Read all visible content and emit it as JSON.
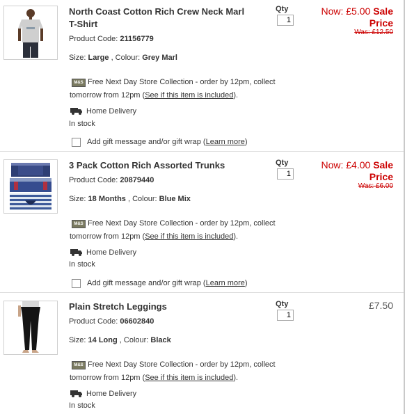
{
  "items": [
    {
      "title_line1": "North Coast Cotton Rich Crew Neck Marl",
      "title_line2": "T-Shirt",
      "product_code_label": "Product Code:",
      "product_code": "21156779",
      "size_label": "Size:",
      "size": "Large",
      "colour_label": ", Colour:",
      "colour": "Grey Marl",
      "qty_label": "Qty",
      "qty": "1",
      "price_now_prefix": "Now: £5.00",
      "price_now_sale": "Sale",
      "price_now_price": "Price",
      "price_was": "Was: £12.50",
      "store_line1": "Free Next Day Store Collection - order by 12pm, collect",
      "store_line2_pre": "tomorrow  from 12pm (",
      "store_link": "See if this item is included",
      "store_line2_post": ").",
      "home_delivery": "Home Delivery",
      "stock": "In stock",
      "gift_text": "Add gift message and/or gift wrap (",
      "gift_link": "Learn more",
      "gift_close": ")"
    },
    {
      "title_line1": "3 Pack Cotton Rich Assorted Trunks",
      "product_code_label": "Product Code:",
      "product_code": "20879440",
      "size_label": "Size:",
      "size": "18 Months",
      "colour_label": ", Colour:",
      "colour": "Blue Mix",
      "qty_label": "Qty",
      "qty": "1",
      "price_now_prefix": "Now: £4.00",
      "price_now_sale": "Sale",
      "price_now_price": "Price",
      "price_was": "Was: £6.00",
      "store_line1": "Free Next Day Store Collection - order by 12pm, collect",
      "store_line2_pre": "tomorrow  from 12pm (",
      "store_link": "See if this item is included",
      "store_line2_post": ").",
      "home_delivery": "Home Delivery",
      "stock": "In stock",
      "gift_text": "Add gift message and/or gift wrap (",
      "gift_link": "Learn more",
      "gift_close": ")"
    },
    {
      "title_line1": "Plain Stretch Leggings",
      "product_code_label": "Product Code:",
      "product_code": "06602840",
      "size_label": "Size:",
      "size": "14 Long",
      "colour_label": ", Colour:",
      "colour": "Black",
      "qty_label": "Qty",
      "qty": "1",
      "price": "£7.50",
      "store_line1": "Free Next Day Store Collection - order by 12pm, collect",
      "store_line2_pre": "tomorrow  from 12pm (",
      "store_link": "See if this item is included",
      "store_line2_post": ").",
      "home_delivery": "Home Delivery",
      "stock": "In stock"
    }
  ],
  "icons": {
    "store": "M&S",
    "delivery": "delivery-truck-icon"
  },
  "colors": {
    "sale_red": "#cc0000",
    "text": "#333333",
    "divider": "#dcdcdc"
  }
}
